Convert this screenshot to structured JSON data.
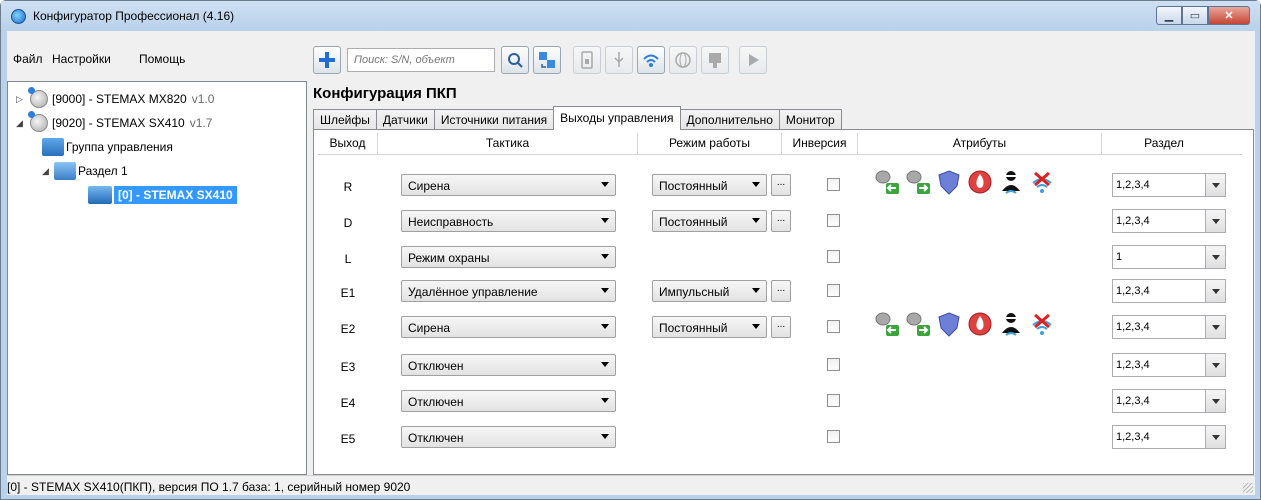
{
  "window": {
    "title": "Конфигуратор Профессионал (4.16)",
    "controls": {
      "minimize": "▁",
      "maximize": "▭",
      "close": "✕"
    }
  },
  "menu": [
    "Файл",
    "Настройки",
    "Помощь"
  ],
  "toolbar": {
    "search_placeholder": "Поиск: S/N, объект",
    "buttons": [
      "add-icon",
      "search-go-icon",
      "connect-icon",
      "sim-card-icon",
      "usb-icon",
      "wifi-icon",
      "globe-icon",
      "tag-icon",
      "play-icon"
    ]
  },
  "tree": {
    "items": [
      {
        "label": "[9000] - STEMAX MX820",
        "version": "v1.0",
        "expander": "▷"
      },
      {
        "label": "[9020] - STEMAX SX410",
        "version": "v1.7",
        "expander": "◢"
      },
      {
        "label": "Группа управления"
      },
      {
        "label": "Раздел 1",
        "expander": "◢"
      },
      {
        "label": "[0] - STEMAX SX410"
      }
    ]
  },
  "panel": {
    "title": "Конфигурация ПКП",
    "tabs": [
      "Шлейфы",
      "Датчики",
      "Источники питания",
      "Выходы управления",
      "Дополнительно",
      "Монитор"
    ],
    "active_tab": "Выходы управления"
  },
  "grid": {
    "headers": [
      "Выход",
      "Тактика",
      "Режим работы",
      "Инверсия",
      "Атрибуты",
      "Раздел"
    ],
    "rows": [
      {
        "out": "R",
        "tactic": "Сирена",
        "mode": "Постоянный",
        "has_mode": true,
        "inverted": false,
        "attributes": true,
        "partition": "1,2,3,4"
      },
      {
        "out": "D",
        "tactic": "Неисправность",
        "mode": "Постоянный",
        "has_mode": true,
        "inverted": false,
        "attributes": false,
        "partition": "1,2,3,4"
      },
      {
        "out": "L",
        "tactic": "Режим охраны",
        "mode": "",
        "has_mode": false,
        "inverted": false,
        "attributes": false,
        "partition": "1"
      },
      {
        "out": "E1",
        "tactic": "Удалённое управление",
        "mode": "Импульсный",
        "has_mode": true,
        "inverted": false,
        "attributes": false,
        "partition": "1,2,3,4"
      },
      {
        "out": "E2",
        "tactic": "Сирена",
        "mode": "Постоянный",
        "has_mode": true,
        "inverted": false,
        "attributes": true,
        "partition": "1,2,3,4"
      },
      {
        "out": "E3",
        "tactic": "Отключен",
        "mode": "",
        "has_mode": false,
        "inverted": false,
        "attributes": false,
        "partition": "1,2,3,4"
      },
      {
        "out": "E4",
        "tactic": "Отключен",
        "mode": "",
        "has_mode": false,
        "inverted": false,
        "attributes": false,
        "partition": "1,2,3,4"
      },
      {
        "out": "E5",
        "tactic": "Отключен",
        "mode": "",
        "has_mode": false,
        "inverted": false,
        "attributes": false,
        "partition": "1,2,3,4"
      }
    ],
    "attribute_icons": [
      "speaker-in-icon",
      "speaker-out-icon",
      "shield-icon",
      "fire-icon",
      "burglar-icon",
      "wireless-off-icon"
    ],
    "dots_label": "..."
  },
  "status": {
    "text": "[0] - STEMAX SX410(ПКП), версия ПО 1.7 база: 1, серийный номер 9020"
  }
}
